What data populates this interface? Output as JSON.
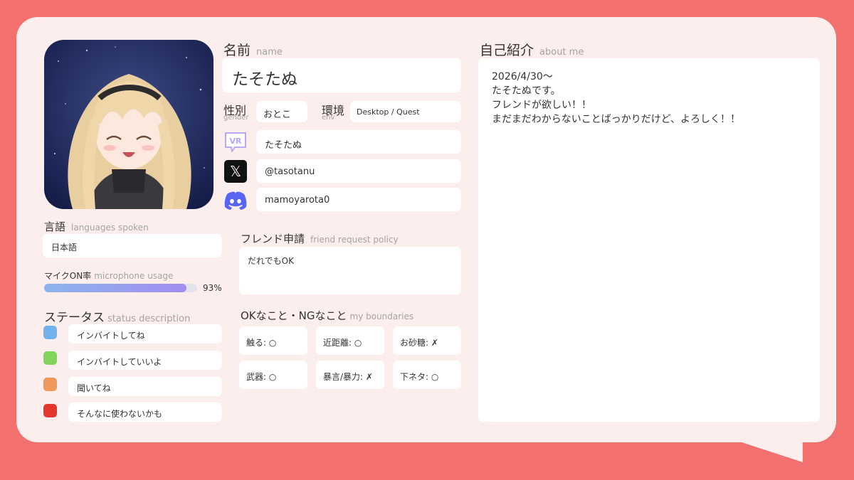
{
  "name": {
    "label": "名前",
    "sub": "name",
    "value": "たそたぬ"
  },
  "gender": {
    "label": "性別",
    "sub": "gender",
    "value": "おとこ"
  },
  "env": {
    "label": "環境",
    "sub": "env",
    "value": "Desktop / Quest"
  },
  "accounts": {
    "vrchat": {
      "icon": "vrchat-icon",
      "glyph": "VR",
      "value": "たそたぬ"
    },
    "x": {
      "icon": "x-icon",
      "glyph": "𝕏",
      "value": "@tasotanu"
    },
    "discord": {
      "icon": "discord-icon",
      "value": "mamoyarota0"
    }
  },
  "language": {
    "label": "言語",
    "sub": "languages spoken",
    "value": "日本語"
  },
  "mic": {
    "label": "マイクON率",
    "sub": "microphone usage",
    "value_text": "93%",
    "value": 0.93
  },
  "status": {
    "label": "ステータス",
    "sub": "status description",
    "items": [
      {
        "color": "#72b2ec",
        "text": "インバイトしてね"
      },
      {
        "color": "#82d45c",
        "text": "インバイトしていいよ"
      },
      {
        "color": "#f0985c",
        "text": "聞いてね"
      },
      {
        "color": "#e6372e",
        "text": "そんなに使わないかも"
      }
    ]
  },
  "friend": {
    "label": "フレンド申請",
    "sub": "friend request policy",
    "value": "だれでもOK"
  },
  "boundaries": {
    "label": "OKなこと・NGなこと",
    "sub": "my boundaries",
    "items": [
      "触る: ○",
      "近距離: ○",
      "お砂糖: ✗",
      "武器: ○",
      "暴言/暴力: ✗",
      "下ネタ: ○"
    ]
  },
  "about": {
    "label": "自己紹介",
    "sub": "about me",
    "lines": [
      "2026/4/30〜",
      "たそたぬです。",
      "フレンドが欲しい！！",
      "まだまだわからないことばっかりだけど、よろしく！！"
    ]
  },
  "colors": {
    "background": "#f2706d",
    "card": "#fbeeed",
    "mic_bar": "#9aa8f2"
  }
}
